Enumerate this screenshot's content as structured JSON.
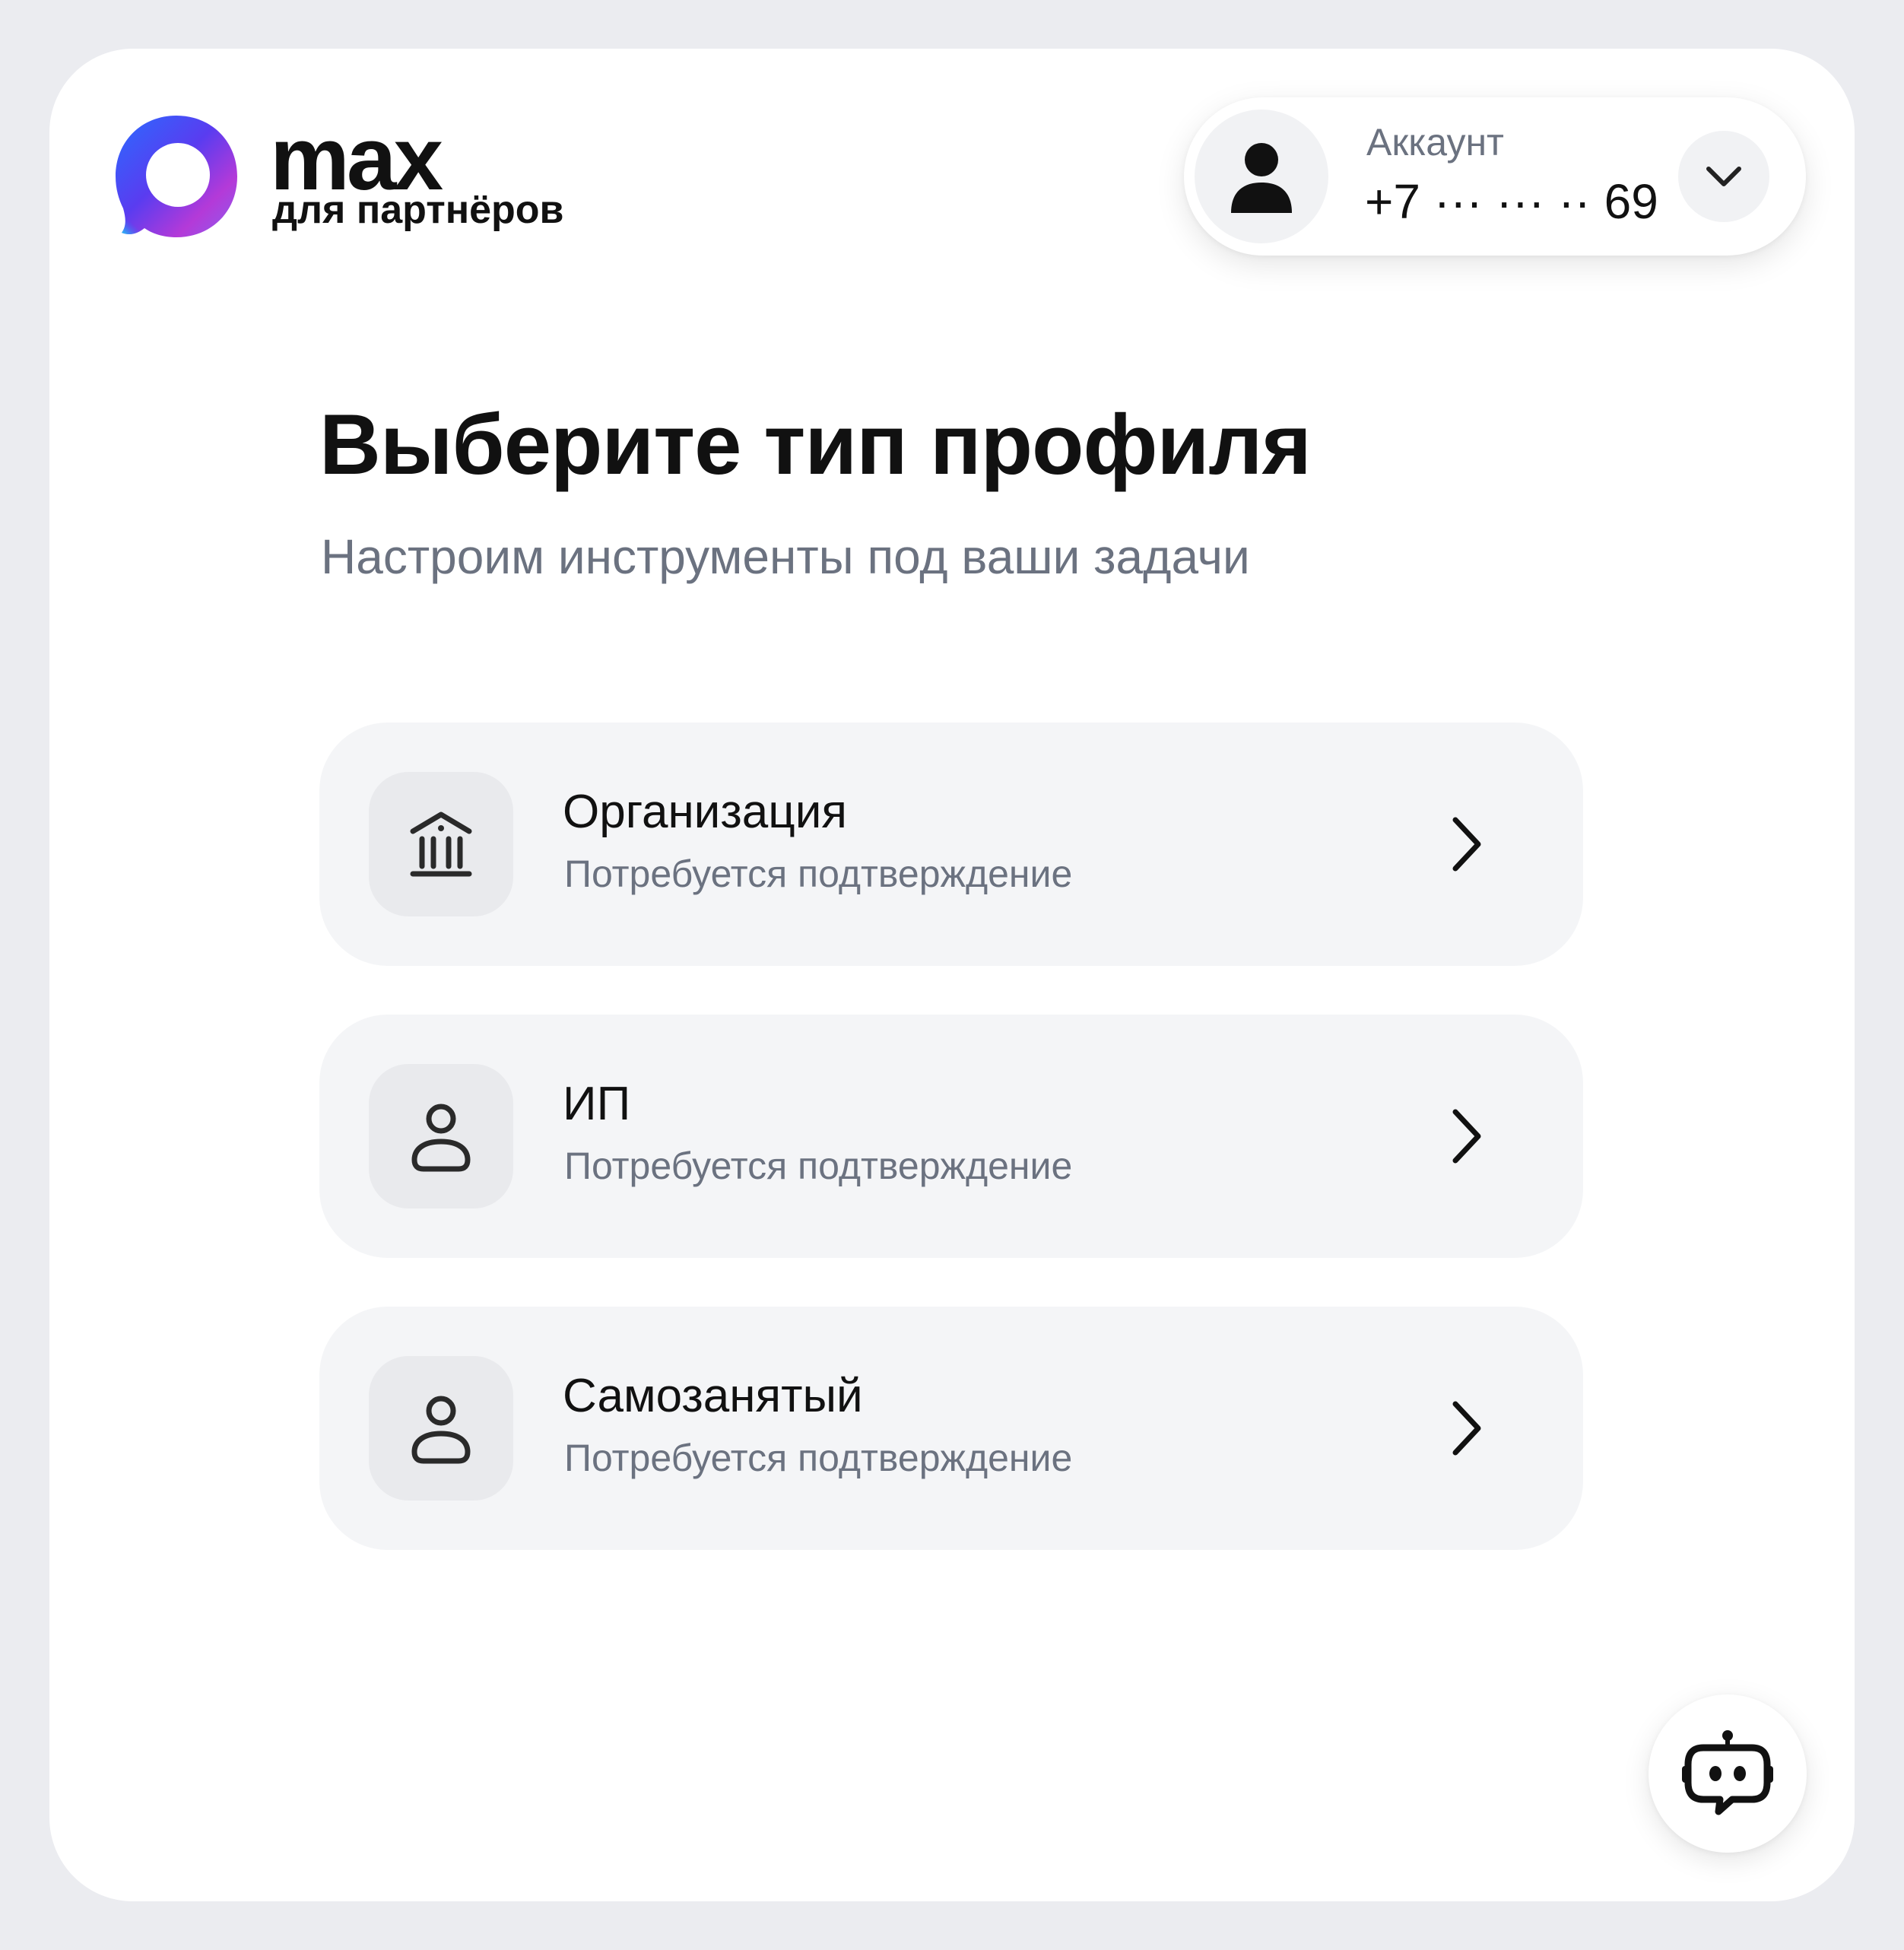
{
  "brand": {
    "name": "max",
    "subtitle": "для партнёров"
  },
  "account": {
    "label": "Аккаунт",
    "phone": "+7 ··· ··· ·· 69",
    "avatar_icon": "user-avatar-icon",
    "toggle_icon": "chevron-down-icon"
  },
  "page": {
    "title": "Выберите тип профиля",
    "subtitle": "Настроим инструменты под ваши задачи"
  },
  "options": [
    {
      "title": "Организация",
      "subtitle": "Потребуется подтверждение",
      "icon": "bank-icon"
    },
    {
      "title": "ИП",
      "subtitle": "Потребуется подтверждение",
      "icon": "person-icon"
    },
    {
      "title": "Самозанятый",
      "subtitle": "Потребуется подтверждение",
      "icon": "person-icon"
    }
  ],
  "assistant": {
    "icon": "bot-icon"
  },
  "colors": {
    "background": "#ebecf0",
    "panel": "#ffffff",
    "card": "#f4f5f7",
    "muted_text": "#6b7280",
    "logo_gradient": [
      "#2a6bff",
      "#7b3cf0",
      "#c13ad8",
      "#27c4f0"
    ]
  }
}
